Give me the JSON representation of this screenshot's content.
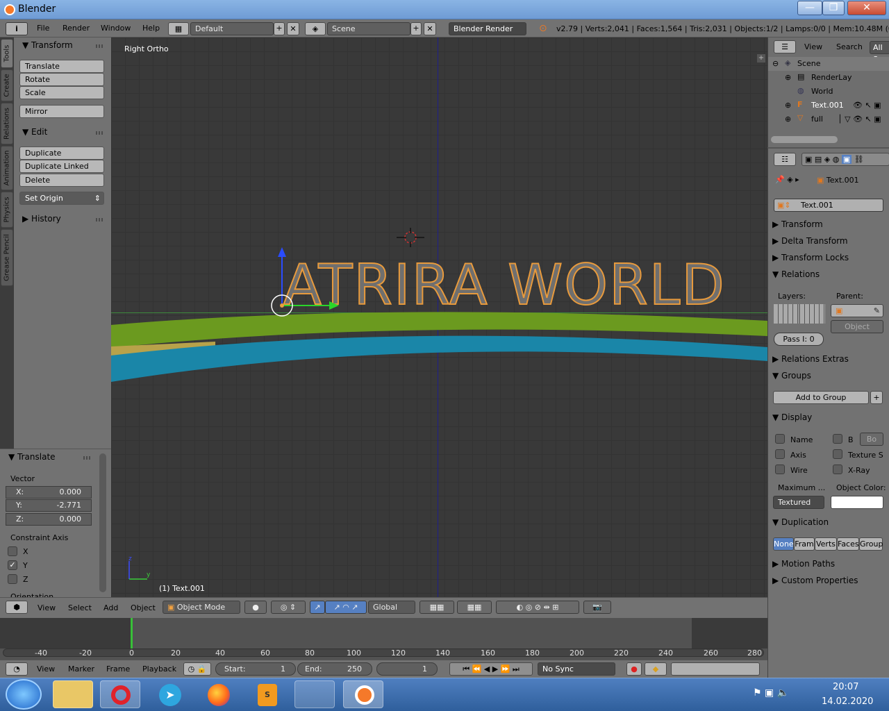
{
  "window": {
    "title": "Blender",
    "minimize": "—",
    "maximize": "❐",
    "close": "✕"
  },
  "menu": {
    "info_icon": "i",
    "items": [
      "File",
      "Render",
      "Window",
      "Help"
    ]
  },
  "screen_layout": {
    "value": "Default",
    "add": "+",
    "close": "✕"
  },
  "scene": {
    "value": "Scene",
    "add": "+",
    "close": "✕"
  },
  "render_engine": {
    "value": "Blender Render"
  },
  "stats": "v2.79 | Verts:2,041 | Faces:1,564 | Tris:2,031 | Objects:1/2 | Lamps:0/0 | Mem:10.48M (0.11M",
  "tabs": [
    "Tools",
    "Create",
    "Relations",
    "Animation",
    "Physics",
    "Grease Pencil"
  ],
  "toolshelf": {
    "transform": {
      "title": "Transform",
      "buttons": [
        "Translate",
        "Rotate",
        "Scale"
      ],
      "mirror": "Mirror"
    },
    "edit": {
      "title": "Edit",
      "buttons": [
        "Duplicate",
        "Duplicate Linked",
        "Delete"
      ],
      "set_origin": "Set Origin"
    },
    "history": {
      "title": "History"
    }
  },
  "redo": {
    "title": "Translate",
    "vector": "Vector",
    "x_label": "X:",
    "x_value": "0.000",
    "y_label": "Y:",
    "y_value": "-2.771",
    "z_label": "Z:",
    "z_value": "0.000",
    "constraint": "Constraint Axis",
    "axes": [
      {
        "label": "X",
        "checked": false
      },
      {
        "label": "Y",
        "checked": true
      },
      {
        "label": "Z",
        "checked": false
      }
    ],
    "orientation": "Orientation"
  },
  "viewport": {
    "view_name": "Right Ortho",
    "object_text": "ATRIRA WORLD",
    "active_label": "(1) Text.001",
    "axis_z": "z",
    "axis_y": "y"
  },
  "view3d_header": {
    "menus": [
      "View",
      "Select",
      "Add",
      "Object"
    ],
    "mode": "Object Mode",
    "orientation": "Global"
  },
  "timeline": {
    "ticks": [
      "-40",
      "-20",
      "0",
      "20",
      "40",
      "60",
      "80",
      "100",
      "120",
      "140",
      "160",
      "180",
      "200",
      "220",
      "240",
      "260",
      "280"
    ],
    "current_frame_marker": 0
  },
  "timeline_header": {
    "menus": [
      "View",
      "Marker",
      "Frame",
      "Playback"
    ],
    "start_label": "Start:",
    "start": "1",
    "end_label": "End:",
    "end": "250",
    "current": "1",
    "sync": "No Sync"
  },
  "outliner": {
    "menus": [
      "View",
      "Search"
    ],
    "filter": "All S",
    "items": [
      {
        "label": "Scene",
        "level": 0
      },
      {
        "label": "RenderLay",
        "level": 1
      },
      {
        "label": "World",
        "level": 1
      },
      {
        "label": "Text.001",
        "level": 1,
        "selected": true
      },
      {
        "label": "full",
        "level": 1
      }
    ]
  },
  "properties": {
    "breadcrumb": "Text.001",
    "object_name": "Text.001",
    "sections": [
      "Transform",
      "Delta Transform",
      "Transform Locks",
      "Relations"
    ],
    "relations": {
      "layers_label": "Layers:",
      "parent_label": "Parent:",
      "parent_type": "Object",
      "pass_index": "Pass I:  0"
    },
    "sections2": [
      "Relations Extras",
      "Groups"
    ],
    "add_to_group": "Add to Group",
    "display": {
      "title": "Display",
      "left": [
        "Name",
        "Axis",
        "Wire"
      ],
      "right": [
        "B",
        "Texture S",
        "X-Ray"
      ],
      "bo": "Bo",
      "maximum": "Maximum ...",
      "object_color": "Object Color:",
      "draw_type": "Textured"
    },
    "duplication": {
      "title": "Duplication",
      "options": [
        "None",
        "Fram",
        "Verts",
        "Faces",
        "Group"
      ],
      "selected": "None"
    },
    "sections3": [
      "Motion Paths",
      "Custom Properties"
    ]
  },
  "taskbar": {
    "time": "20:07",
    "date": "14.02.2020",
    "apps": [
      "explorer",
      "opera",
      "telegram",
      "firefox",
      "sublime",
      "network-tool",
      "blender"
    ]
  },
  "colors": {
    "accent": "#5680c2",
    "green_strip": "#6b9a1f",
    "blue_strip": "#1a86a8",
    "selection_outline": "#e89a3c"
  }
}
